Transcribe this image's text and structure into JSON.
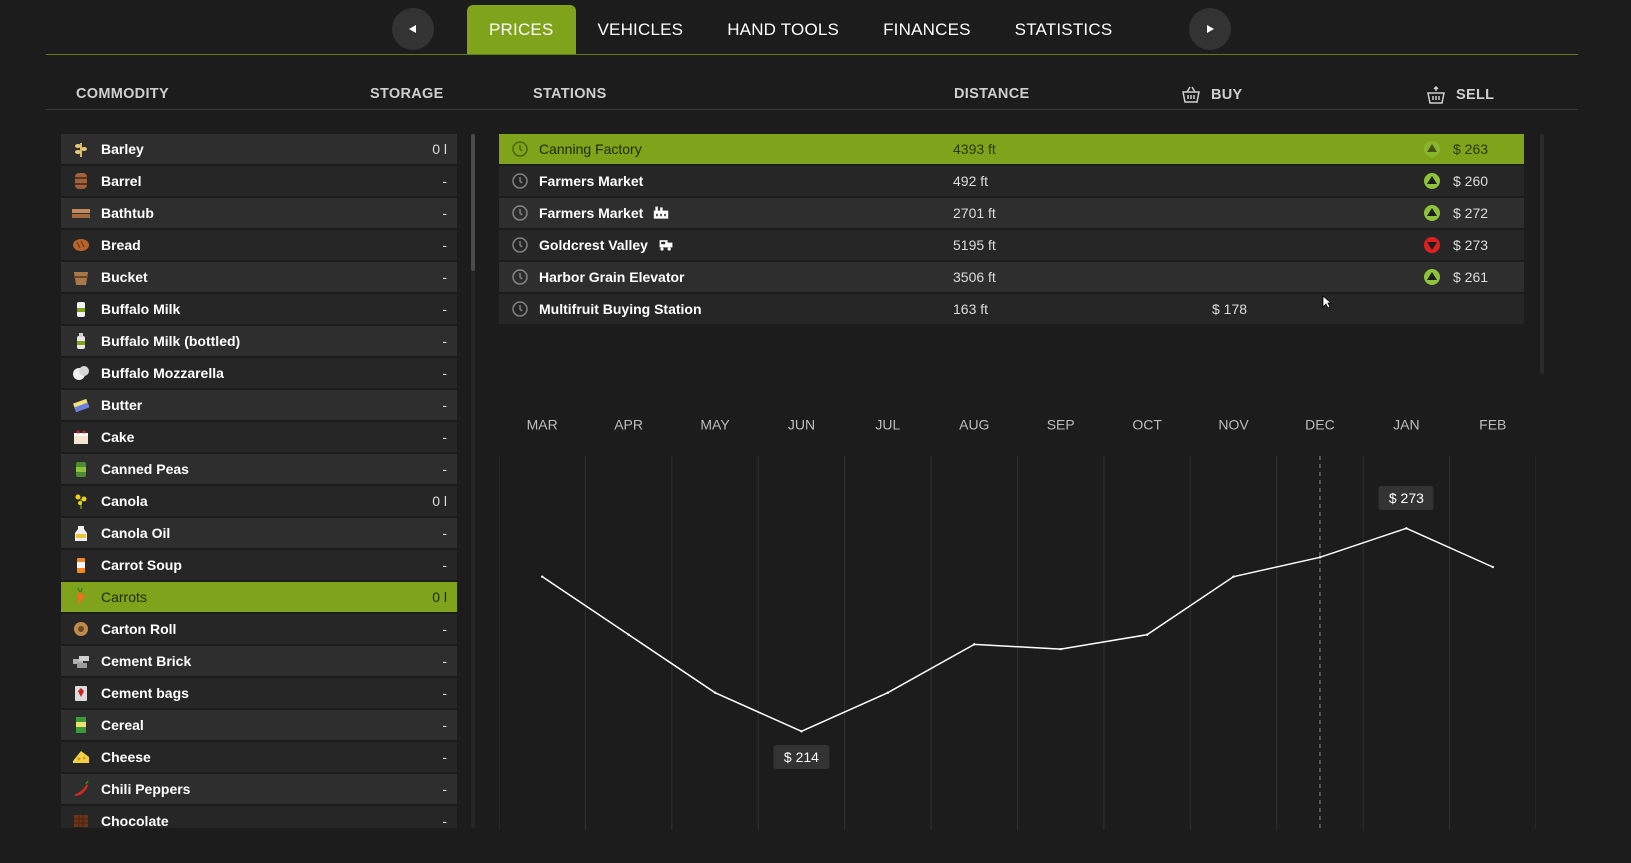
{
  "nav": {
    "tabs": [
      {
        "label": "PRICES",
        "active": true
      },
      {
        "label": "VEHICLES",
        "active": false
      },
      {
        "label": "HAND TOOLS",
        "active": false
      },
      {
        "label": "FINANCES",
        "active": false
      },
      {
        "label": "STATISTICS",
        "active": false
      }
    ],
    "prev_icon": "triangle-left-icon",
    "next_icon": "triangle-right-icon"
  },
  "headers": {
    "commodity": "COMMODITY",
    "storage": "STORAGE",
    "stations": "STATIONS",
    "distance": "DISTANCE",
    "buy": "BUY",
    "sell": "SELL"
  },
  "commodities": [
    {
      "name": "Barley",
      "storage": "0 l",
      "icon": "barley-icon",
      "selected": false
    },
    {
      "name": "Barrel",
      "storage": "-",
      "icon": "barrel-icon",
      "selected": false
    },
    {
      "name": "Bathtub",
      "storage": "-",
      "icon": "bathtub-icon",
      "selected": false
    },
    {
      "name": "Bread",
      "storage": "-",
      "icon": "bread-icon",
      "selected": false
    },
    {
      "name": "Bucket",
      "storage": "-",
      "icon": "bucket-icon",
      "selected": false
    },
    {
      "name": "Buffalo Milk",
      "storage": "-",
      "icon": "buffalo-milk-icon",
      "selected": false
    },
    {
      "name": "Buffalo Milk (bottled)",
      "storage": "-",
      "icon": "milk-bottle-icon",
      "selected": false
    },
    {
      "name": "Buffalo Mozzarella",
      "storage": "-",
      "icon": "mozzarella-icon",
      "selected": false
    },
    {
      "name": "Butter",
      "storage": "-",
      "icon": "butter-icon",
      "selected": false
    },
    {
      "name": "Cake",
      "storage": "-",
      "icon": "cake-icon",
      "selected": false
    },
    {
      "name": "Canned Peas",
      "storage": "-",
      "icon": "canned-peas-icon",
      "selected": false
    },
    {
      "name": "Canola",
      "storage": "0 l",
      "icon": "canola-icon",
      "selected": false
    },
    {
      "name": "Canola Oil",
      "storage": "-",
      "icon": "canola-oil-icon",
      "selected": false
    },
    {
      "name": "Carrot Soup",
      "storage": "-",
      "icon": "carrot-soup-icon",
      "selected": false
    },
    {
      "name": "Carrots",
      "storage": "0 l",
      "icon": "carrot-icon",
      "selected": true
    },
    {
      "name": "Carton Roll",
      "storage": "-",
      "icon": "carton-roll-icon",
      "selected": false
    },
    {
      "name": "Cement Brick",
      "storage": "-",
      "icon": "cement-brick-icon",
      "selected": false
    },
    {
      "name": "Cement bags",
      "storage": "-",
      "icon": "cement-bags-icon",
      "selected": false
    },
    {
      "name": "Cereal",
      "storage": "-",
      "icon": "cereal-icon",
      "selected": false
    },
    {
      "name": "Cheese",
      "storage": "-",
      "icon": "cheese-icon",
      "selected": false
    },
    {
      "name": "Chili Peppers",
      "storage": "-",
      "icon": "chili-pepper-icon",
      "selected": false
    },
    {
      "name": "Chocolate",
      "storage": "-",
      "icon": "chocolate-icon",
      "selected": false
    }
  ],
  "stations": [
    {
      "name": "Canning Factory",
      "type_icon": "",
      "distance": "4393 ft",
      "buy": "",
      "trend": "up",
      "sell": "$ 263",
      "selected": true
    },
    {
      "name": "Farmers Market",
      "type_icon": "",
      "distance": "492 ft",
      "buy": "",
      "trend": "up",
      "sell": "$ 260",
      "selected": false
    },
    {
      "name": "Farmers Market",
      "type_icon": "factory-icon",
      "distance": "2701 ft",
      "buy": "",
      "trend": "up",
      "sell": "$ 272",
      "selected": false
    },
    {
      "name": "Goldcrest Valley",
      "type_icon": "train-icon",
      "distance": "5195 ft",
      "buy": "",
      "trend": "down",
      "sell": "$ 273",
      "selected": false
    },
    {
      "name": "Harbor Grain Elevator",
      "type_icon": "",
      "distance": "3506 ft",
      "buy": "",
      "trend": "up",
      "sell": "$ 261",
      "selected": false
    },
    {
      "name": "Multifruit Buying Station",
      "type_icon": "",
      "distance": "163 ft",
      "buy": "$ 178",
      "trend": "",
      "sell": "",
      "selected": false
    }
  ],
  "colors": {
    "accent": "#7fa31a",
    "trend_up": "#8fc23a",
    "trend_down": "#e02020",
    "background": "#1c1c1c"
  },
  "chart_data": {
    "type": "line",
    "categories": [
      "MAR",
      "APR",
      "MAY",
      "JUN",
      "JUL",
      "AUG",
      "SEP",
      "OCT",
      "NOV",
      "DEC",
      "JAN",
      "FEB"
    ],
    "series": [
      {
        "values": [
          230,
          224,
          218,
          214,
          218,
          223,
          222.5,
          224,
          230,
          232,
          235,
          231
        ]
      }
    ],
    "ylim": [
      210,
      240
    ],
    "current_month": "DEC",
    "annotations": [
      {
        "category": "JUN",
        "label": "$ 214"
      },
      {
        "category": "JAN",
        "label": "$ 273"
      }
    ],
    "grid": true
  }
}
